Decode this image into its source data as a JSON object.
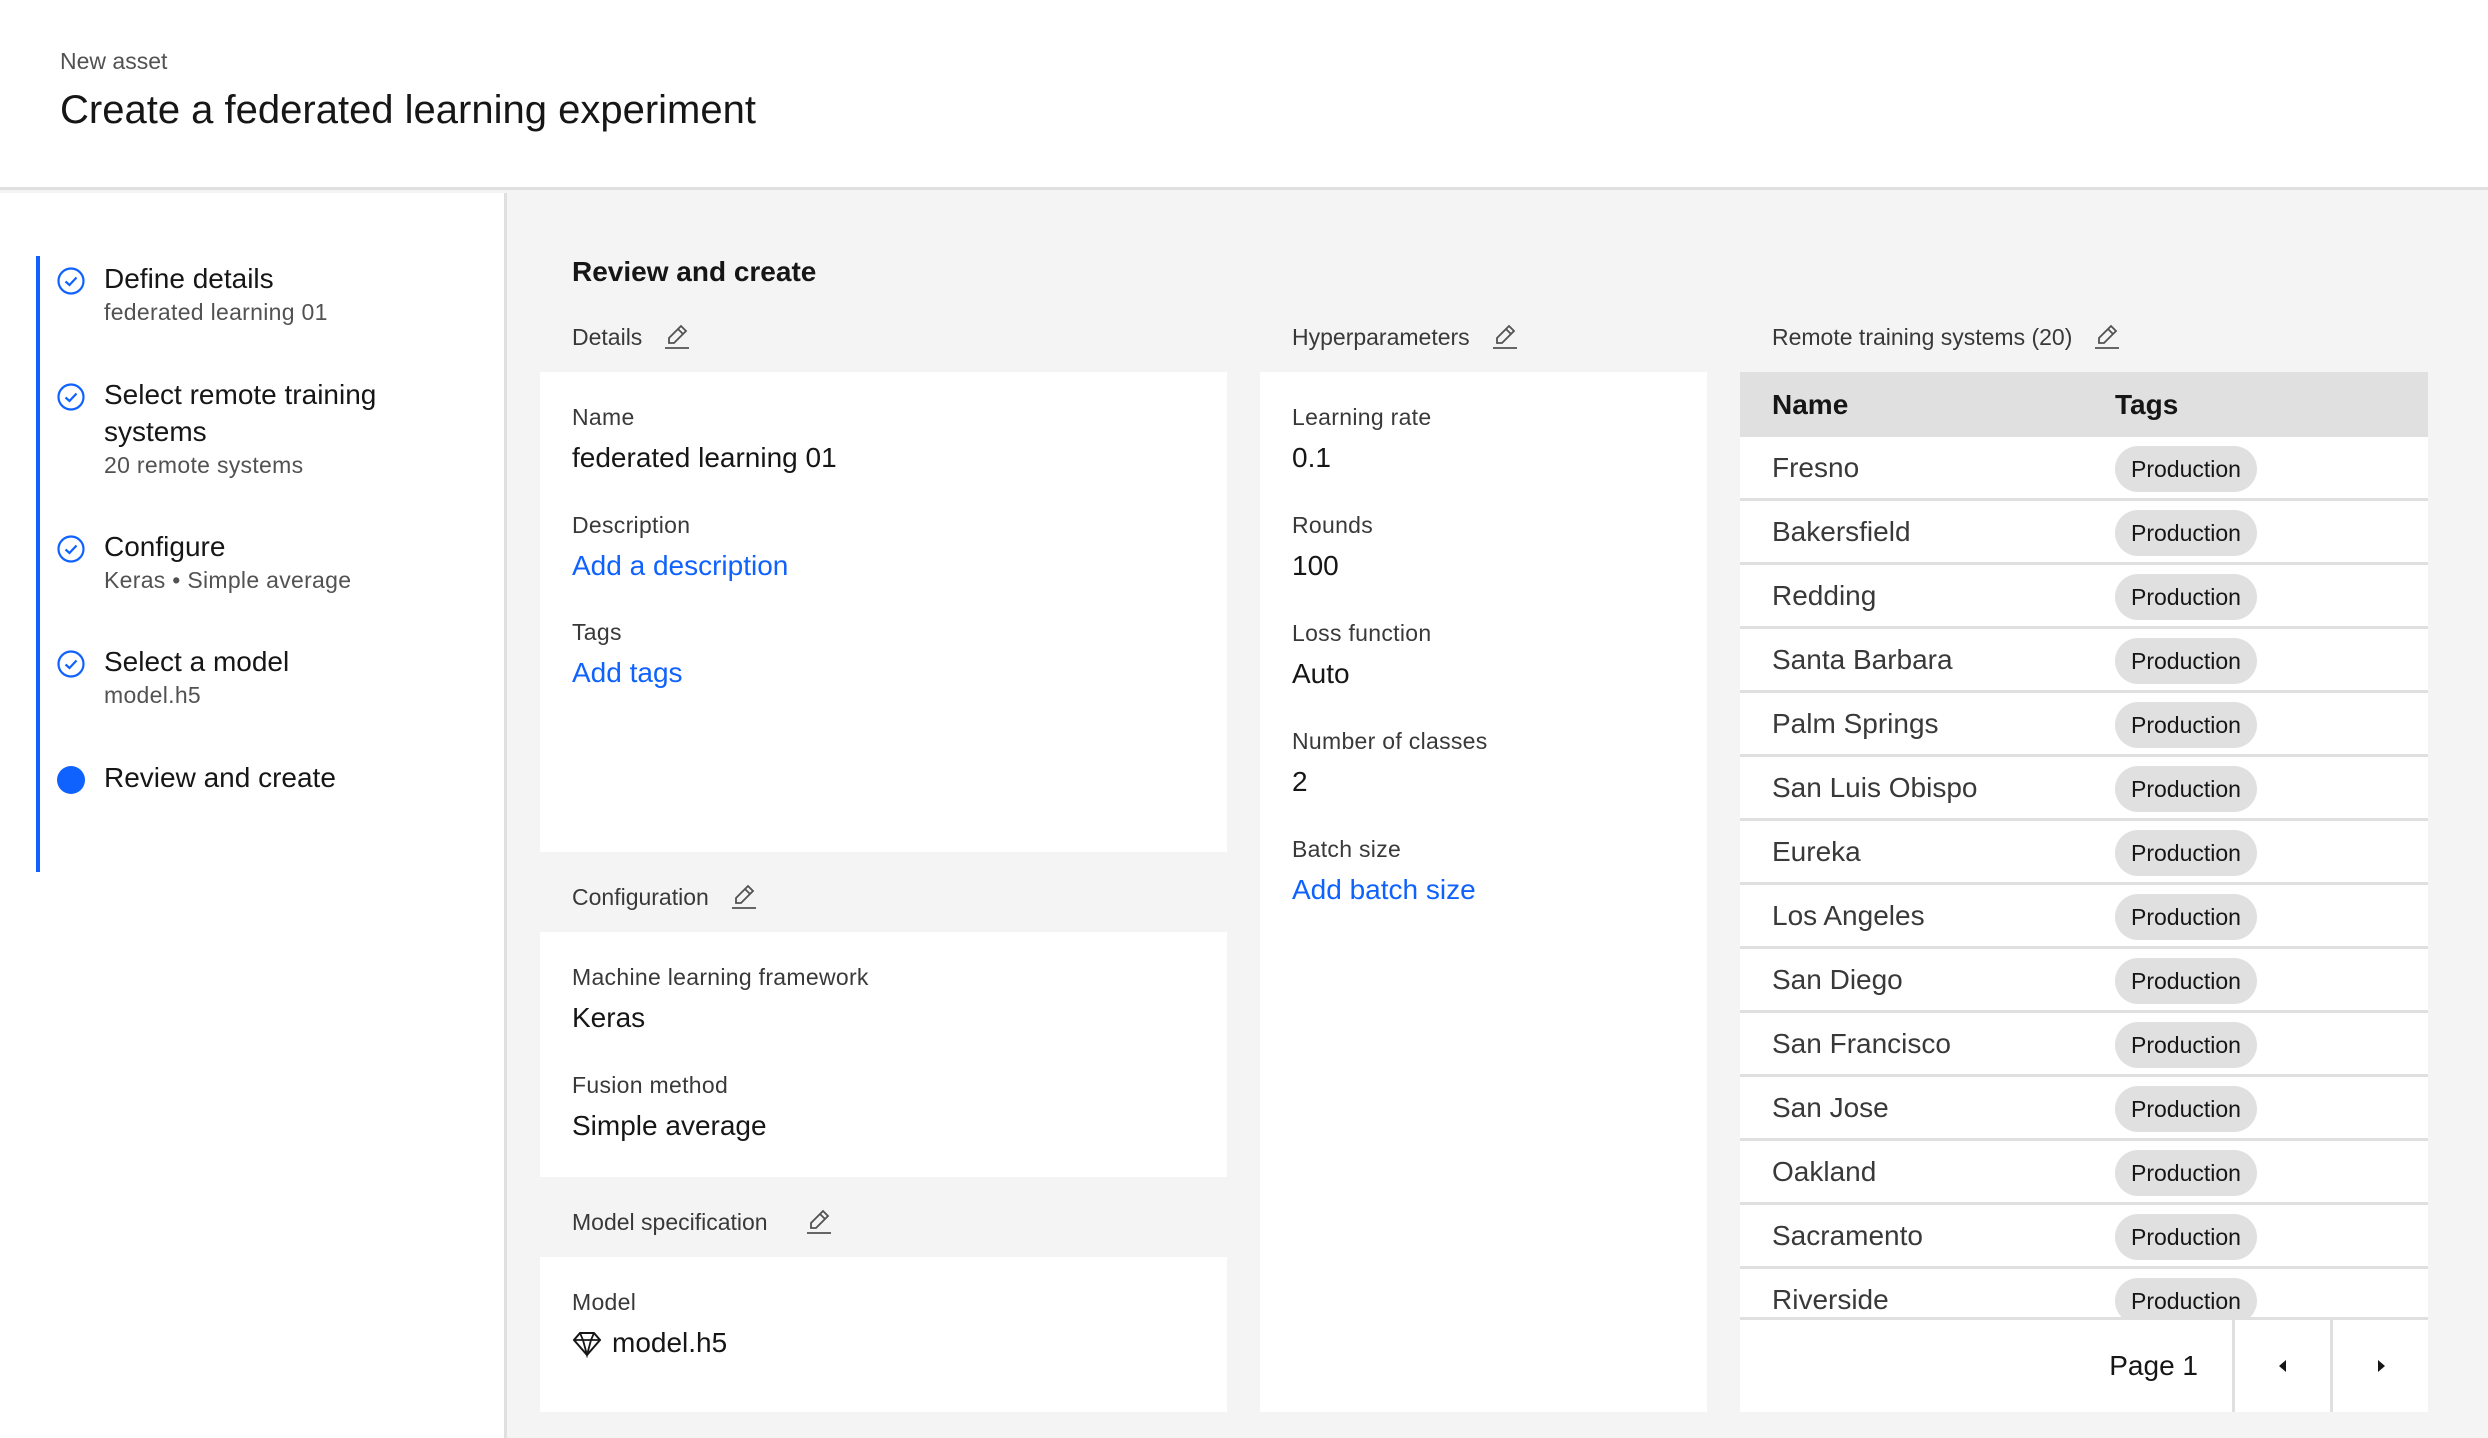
{
  "header": {
    "eyebrow": "New asset",
    "title": "Create a federated learning experiment"
  },
  "colors": {
    "accent": "#0f62fe",
    "background": "#f4f4f4",
    "tag_background": "#e0e0e0"
  },
  "steps": [
    {
      "title": "Define details",
      "subtitle": "federated learning 01",
      "status": "complete",
      "icon": "checkmark-outline-icon"
    },
    {
      "title": "Select remote training systems",
      "subtitle": "20 remote systems",
      "status": "complete",
      "icon": "checkmark-outline-icon"
    },
    {
      "title": "Configure",
      "subtitle": "Keras • Simple average",
      "status": "complete",
      "icon": "checkmark-outline-icon"
    },
    {
      "title": "Select a model",
      "subtitle": "model.h5",
      "status": "complete",
      "icon": "checkmark-outline-icon"
    },
    {
      "title": "Review and create",
      "subtitle": "",
      "status": "current",
      "icon": "current-step-icon"
    }
  ],
  "main": {
    "title": "Review and create",
    "details": {
      "label": "Details",
      "edit_icon": "edit-icon",
      "fields": {
        "name_label": "Name",
        "name_value": "federated learning 01",
        "description_label": "Description",
        "description_link": "Add a description",
        "tags_label": "Tags",
        "tags_link": "Add tags"
      }
    },
    "configuration": {
      "label": "Configuration",
      "edit_icon": "edit-icon",
      "fields": {
        "framework_label": "Machine learning framework",
        "framework_value": "Keras",
        "fusion_label": "Fusion method",
        "fusion_value": "Simple average"
      }
    },
    "model_spec": {
      "label": "Model specification",
      "edit_icon": "edit-icon",
      "fields": {
        "model_label": "Model",
        "model_icon": "model-diamond-icon",
        "model_value": "model.h5"
      }
    },
    "hyperparameters": {
      "label": "Hyperparameters",
      "edit_icon": "edit-icon",
      "fields": {
        "learning_rate_label": "Learning rate",
        "learning_rate_value": "0.1",
        "rounds_label": "Rounds",
        "rounds_value": "100",
        "loss_label": "Loss function",
        "loss_value": "Auto",
        "classes_label": "Number of classes",
        "classes_value": "2",
        "batch_label": "Batch size",
        "batch_link": "Add batch size"
      }
    },
    "remote_systems": {
      "label": "Remote training systems (20)",
      "edit_icon": "edit-icon",
      "columns": [
        "Name",
        "Tags"
      ],
      "rows": [
        {
          "name": "Fresno",
          "tag": "Production"
        },
        {
          "name": "Bakersfield",
          "tag": "Production"
        },
        {
          "name": "Redding",
          "tag": "Production"
        },
        {
          "name": "Santa Barbara",
          "tag": "Production"
        },
        {
          "name": "Palm Springs",
          "tag": "Production"
        },
        {
          "name": "San Luis Obispo",
          "tag": "Production"
        },
        {
          "name": "Eureka",
          "tag": "Production"
        },
        {
          "name": "Los Angeles",
          "tag": "Production"
        },
        {
          "name": "San Diego",
          "tag": "Production"
        },
        {
          "name": "San Francisco",
          "tag": "Production"
        },
        {
          "name": "San Jose",
          "tag": "Production"
        },
        {
          "name": "Oakland",
          "tag": "Production"
        },
        {
          "name": "Sacramento",
          "tag": "Production"
        },
        {
          "name": "Riverside",
          "tag": "Production"
        }
      ],
      "pagination": {
        "page_label": "Page 1",
        "prev_icon": "caret-left-icon",
        "next_icon": "caret-right-icon"
      }
    }
  }
}
